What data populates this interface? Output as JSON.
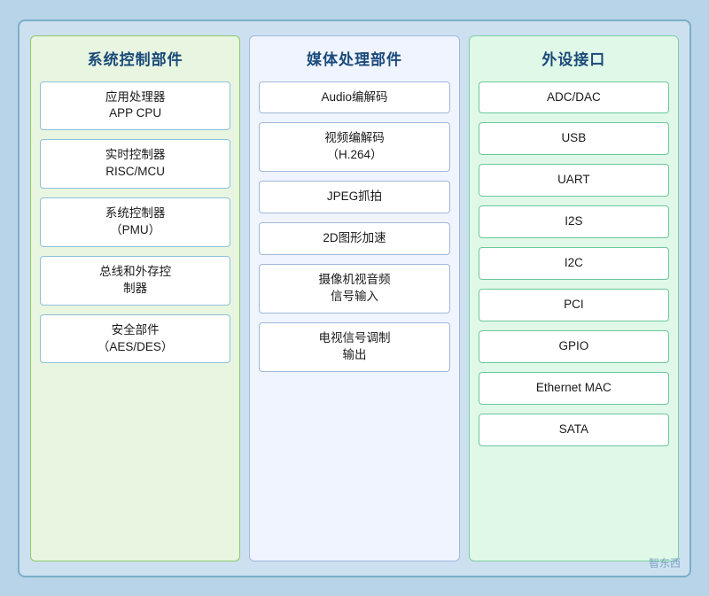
{
  "columns": [
    {
      "id": "system",
      "title": "系统控制部件",
      "items": [
        {
          "label": "应用处理器\nAPP CPU"
        },
        {
          "label": "实时控制器\nRISC/MCU"
        },
        {
          "label": "系统控制器\n（PMU）"
        },
        {
          "label": "总线和外存控\n制器"
        },
        {
          "label": "安全部件\n（AES/DES）"
        }
      ]
    },
    {
      "id": "media",
      "title": "媒体处理部件",
      "items": [
        {
          "label": "Audio编解码"
        },
        {
          "label": "视频编解码\n（H.264）"
        },
        {
          "label": "JPEG抓拍"
        },
        {
          "label": "2D图形加速"
        },
        {
          "label": "摄像机视音频\n信号输入"
        },
        {
          "label": "电视信号调制\n输出"
        }
      ]
    },
    {
      "id": "peripheral",
      "title": "外设接口",
      "items": [
        {
          "label": "ADC/DAC"
        },
        {
          "label": "USB"
        },
        {
          "label": "UART"
        },
        {
          "label": "I2S"
        },
        {
          "label": "I2C"
        },
        {
          "label": "PCI"
        },
        {
          "label": "GPIO"
        },
        {
          "label": "Ethernet MAC"
        },
        {
          "label": "SATA"
        }
      ]
    }
  ],
  "watermark": "智东西"
}
